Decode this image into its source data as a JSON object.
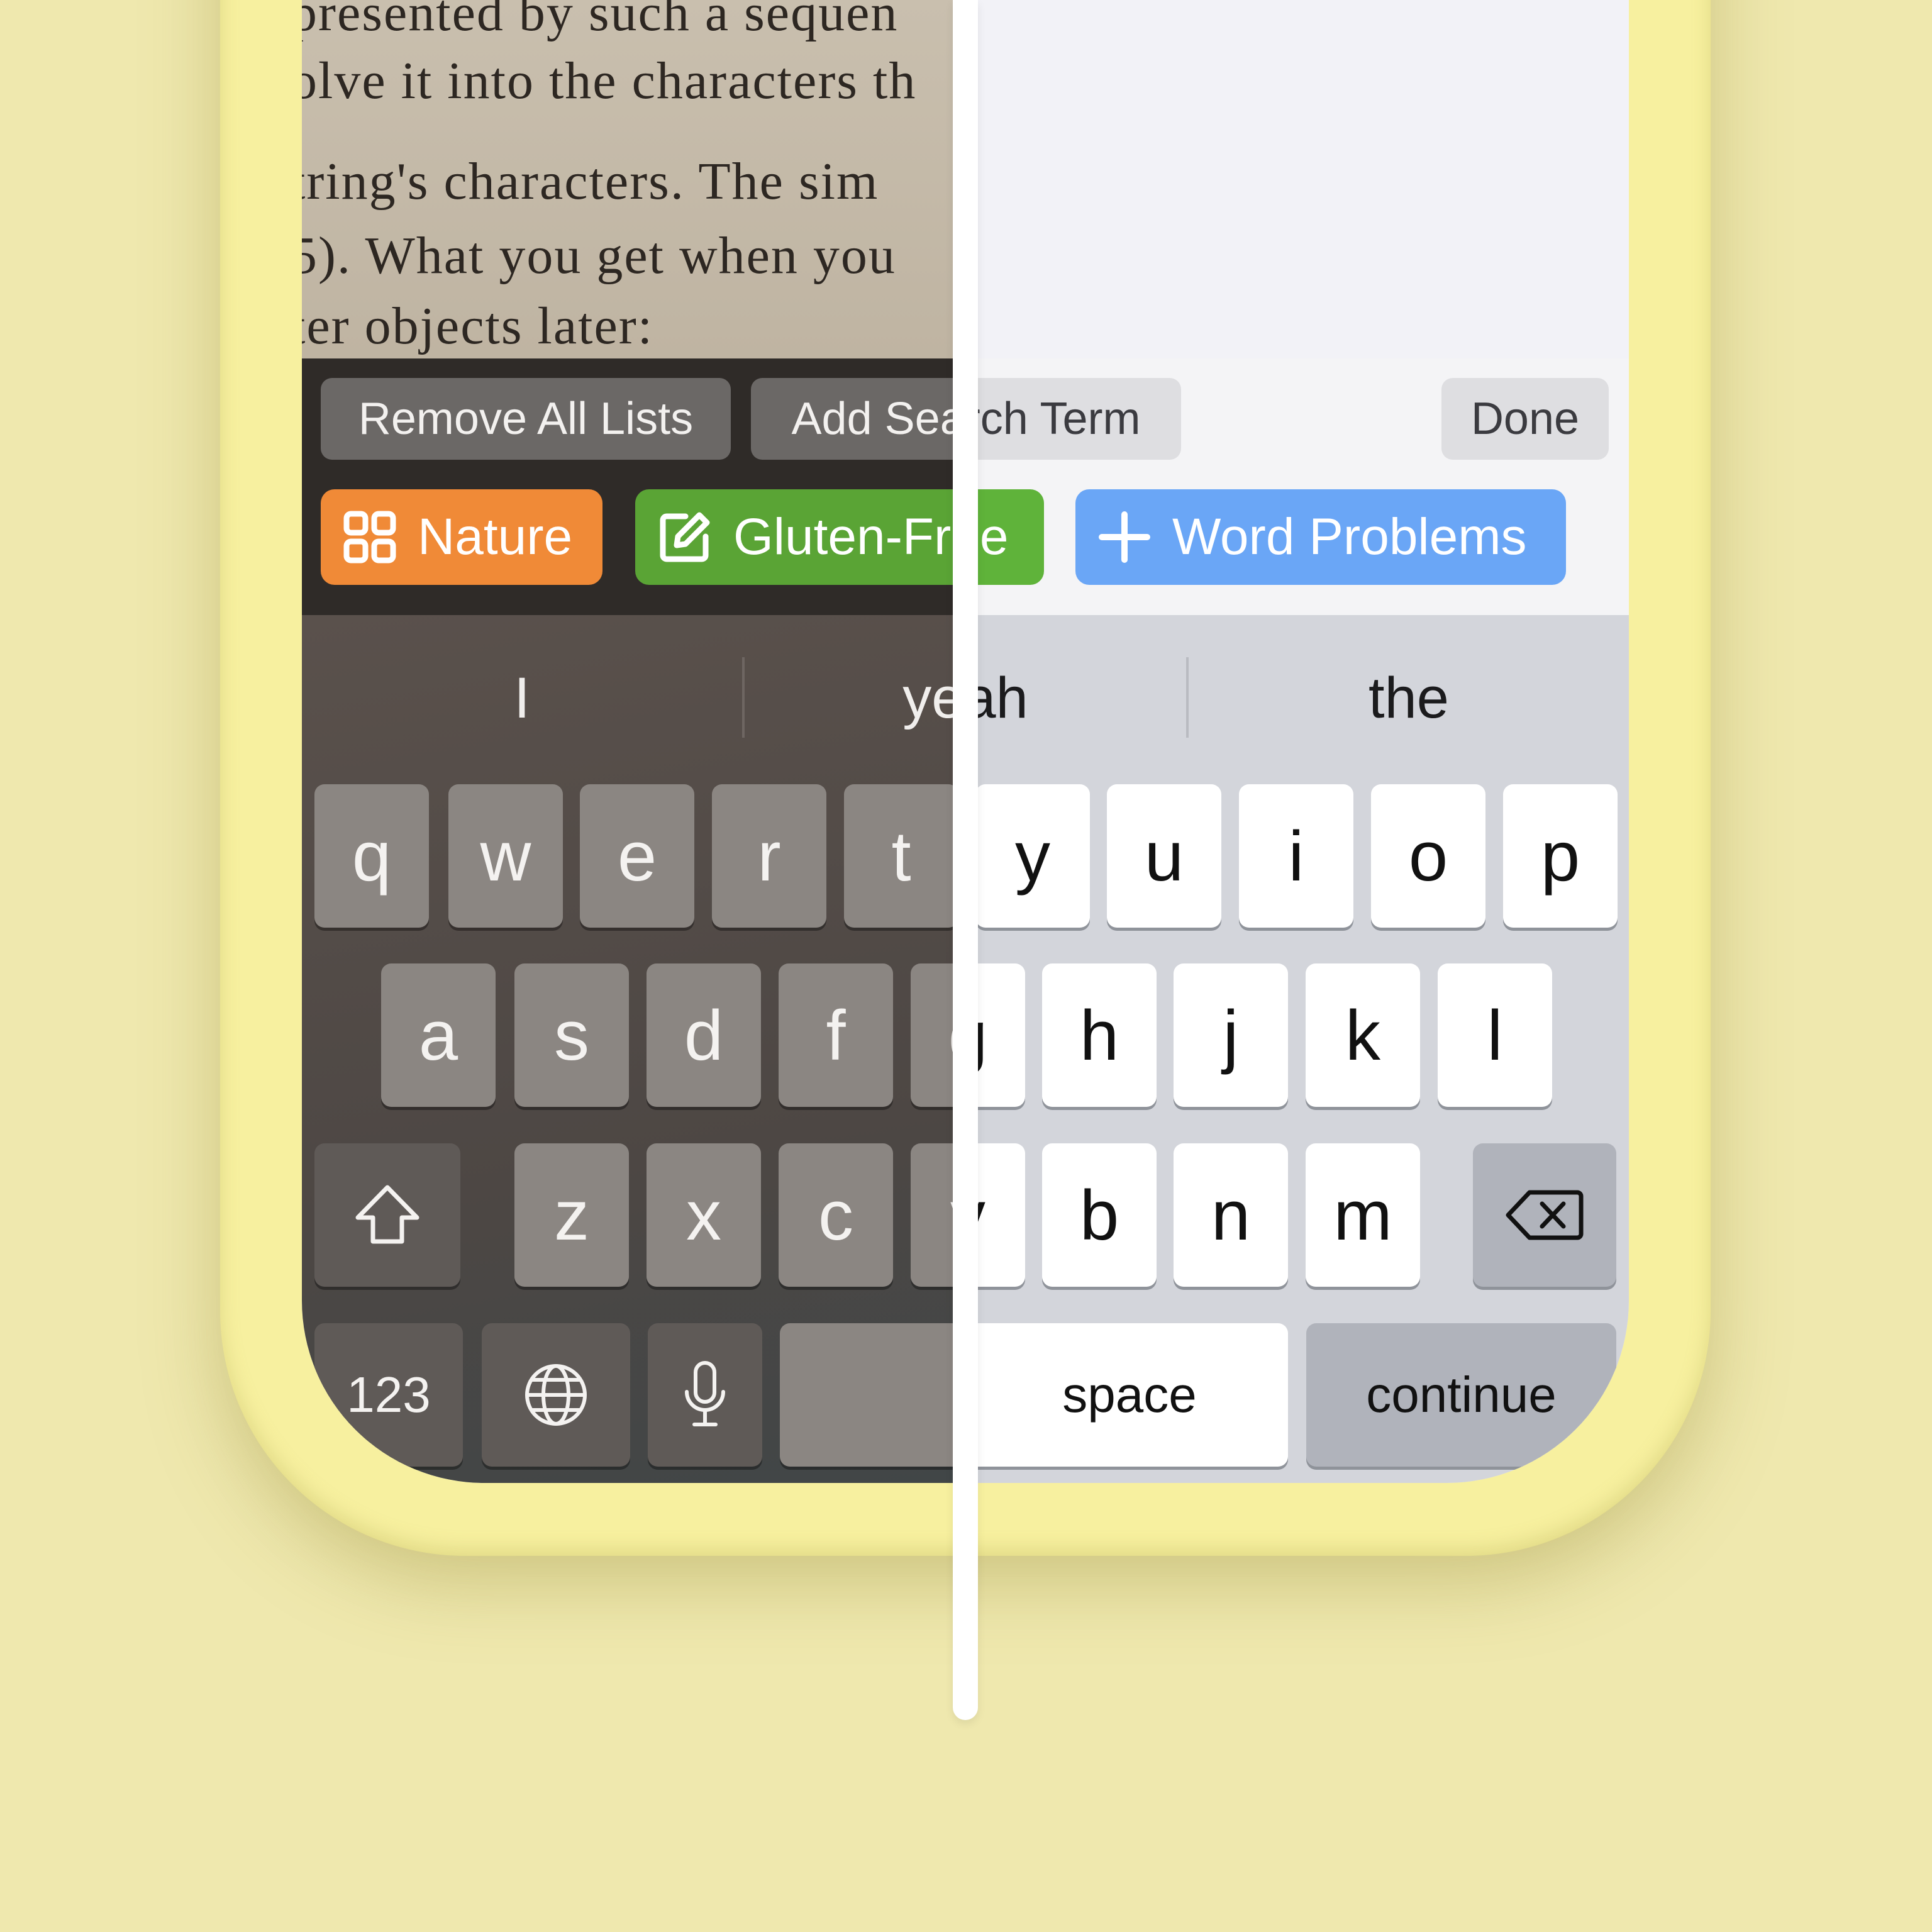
{
  "book_text": {
    "lines": [
      "presented by such a sequen",
      "olve it into the characters th",
      "tring's characters. The sim",
      "5). What you get when you",
      "ter objects later:"
    ]
  },
  "toolbar": {
    "remove_all_lists": "Remove All Lists",
    "add_search_term": "Add Search Term",
    "done": "Done"
  },
  "lists": [
    {
      "label": "Nature",
      "icon": "grid-icon",
      "color": "#f08a37"
    },
    {
      "label": "Gluten-Free",
      "icon": "edit-icon",
      "color": "#5aa435"
    },
    {
      "label": "Word Problems",
      "icon": "plus-icon",
      "color": "#6aa6f6"
    }
  ],
  "suggestions": [
    "I",
    "yeah",
    "the"
  ],
  "keyboard": {
    "row1": [
      "q",
      "w",
      "e",
      "r",
      "t",
      "y",
      "u",
      "i",
      "o",
      "p"
    ],
    "row2": [
      "a",
      "s",
      "d",
      "f",
      "g",
      "h",
      "j",
      "k",
      "l"
    ],
    "row3": [
      "z",
      "x",
      "c",
      "v",
      "b",
      "n",
      "m"
    ],
    "numbers": "123",
    "space": "space",
    "continue": "continue"
  },
  "colors": {
    "background": "#efe8ae",
    "phone_case": "#f7f09f",
    "divider": "#ffffff"
  }
}
